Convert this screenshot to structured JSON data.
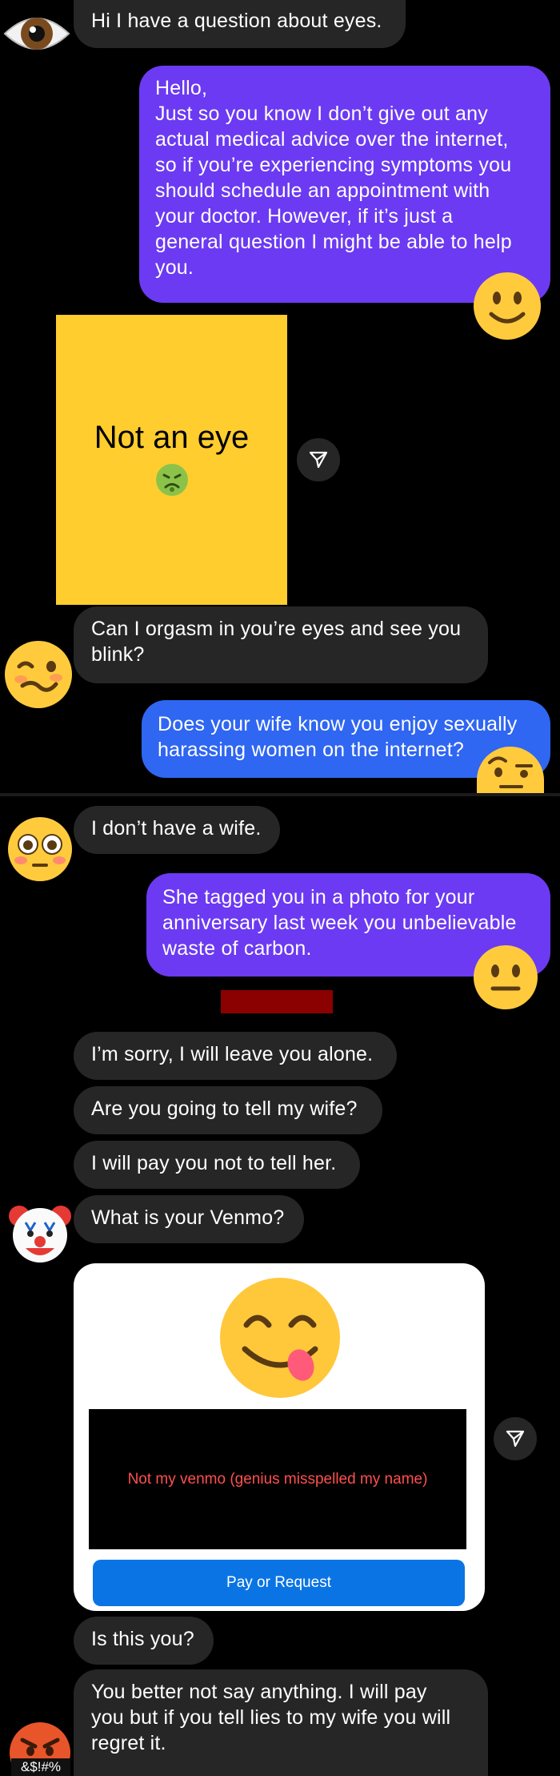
{
  "messages": {
    "m1": "Hi I have a question about eyes.",
    "m2_lines": [
      "Hello,",
      "Just so you know I don’t give out any",
      "actual medical advice over the internet,",
      "so if you’re experiencing symptoms you",
      "should schedule an appointment with",
      "your doctor. However, if it’s just a",
      "general question I might be able to help",
      "you."
    ],
    "note_text": "Not an eye",
    "m3_lines": [
      "Can I orgasm in you’re eyes and see you",
      "blink?"
    ],
    "m4_lines": [
      "Does your wife know you enjoy sexually",
      "harassing women on the internet?"
    ],
    "m5": "I don’t have a wife.",
    "m6_lines": [
      "She tagged you in a photo for your",
      "anniversary last week you unbelievable",
      "waste of carbon."
    ],
    "m7": "I’m sorry, I will leave you alone.",
    "m8": "Are you going to tell my wife?",
    "m9": "I will pay you not to tell her.",
    "m10": "What is your Venmo?",
    "card_caption": "Not my venmo (genius misspelled my name)",
    "card_button": "Pay or Request",
    "m11": "Is this you?",
    "m12_lines": [
      "You better not say anything. I will pay",
      "you but if you tell lies to my wife you will",
      "regret it."
    ],
    "swear_text": "&$!#%"
  },
  "icons": {
    "avatar1": "eye-emoji",
    "reaction_m2": "smiling-face-emoji",
    "note_emoji": "nauseated-face-emoji",
    "avatar2": "woozy-face-emoji",
    "reaction_m4": "raised-eyebrow-face-emoji",
    "avatar3": "flushed-face-emoji",
    "reaction_m6": "neutral-face-emoji",
    "avatar4": "clown-face-emoji",
    "card_emoji": "yum-face-emoji",
    "avatar5": "swearing-face-emoji",
    "share": "paper-plane-icon"
  },
  "colors": {
    "background": "#000000",
    "incoming_bubble": "#262626",
    "outgoing_purple": "#6c3af2",
    "outgoing_blue": "#2f66f2",
    "note_yellow": "#ffcd2e",
    "redaction": "#8b0000",
    "card_button": "#0a74e4"
  }
}
